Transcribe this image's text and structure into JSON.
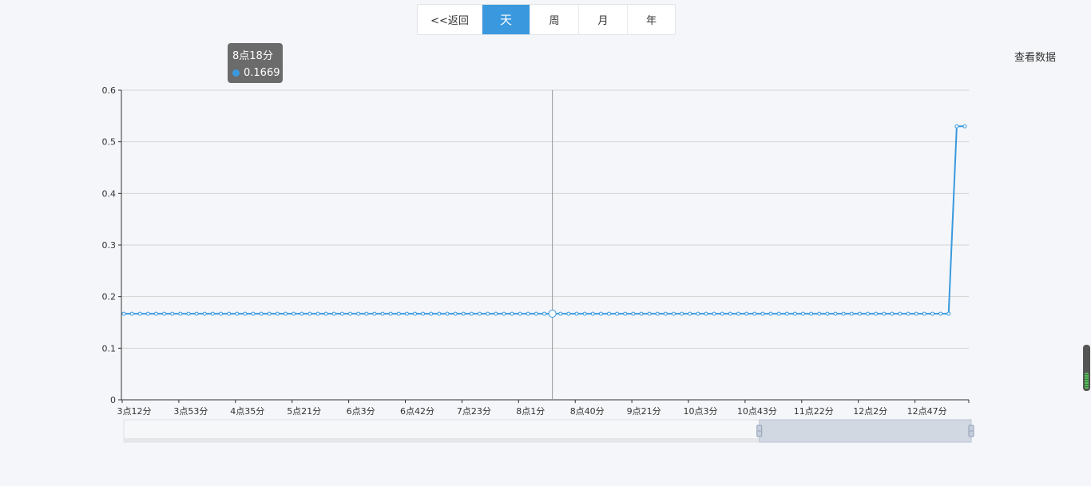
{
  "tabs": [
    {
      "label": "<<返回",
      "active": false
    },
    {
      "label": "天",
      "active": true
    },
    {
      "label": "周",
      "active": false
    },
    {
      "label": "月",
      "active": false
    },
    {
      "label": "年",
      "active": false
    }
  ],
  "view_data_label": "查看数据",
  "tooltip": {
    "time": "8点18分",
    "value": "0.1669"
  },
  "colors": {
    "accent": "#3a99de",
    "series": "#3a99de",
    "grid": "#d4d4d4",
    "tooltip_bg": "#6b6b6b"
  },
  "chart_data": {
    "type": "line",
    "title": "",
    "xlabel": "",
    "ylabel": "",
    "ylim": [
      0,
      0.6
    ],
    "yticks": [
      "0",
      "0.1",
      "0.2",
      "0.3",
      "0.4",
      "0.5",
      "0.6"
    ],
    "x_tick_labels": [
      "3点12分",
      "3点53分",
      "4点35分",
      "5点21分",
      "6点3分",
      "6点42分",
      "7点23分",
      "8点1分",
      "8点40分",
      "9点21分",
      "10点3分",
      "10点43分",
      "11点22分",
      "12点2分",
      "12点47分"
    ],
    "series": [
      {
        "values": [
          0.1669,
          0.1669,
          0.1669,
          0.1669,
          0.1669,
          0.1669,
          0.1669,
          0.1669,
          0.1669,
          0.1669,
          0.1669,
          0.1669,
          0.1669,
          0.1669,
          0.1669,
          0.1669,
          0.1669,
          0.1669,
          0.1669,
          0.1669,
          0.1669,
          0.1669,
          0.1669,
          0.1669,
          0.1669,
          0.1669,
          0.1669,
          0.1669,
          0.1669,
          0.1669,
          0.1669,
          0.1669,
          0.1669,
          0.1669,
          0.1669,
          0.1669,
          0.1669,
          0.1669,
          0.1669,
          0.1669,
          0.1669,
          0.1669,
          0.1669,
          0.1669,
          0.1669,
          0.1669,
          0.1669,
          0.1669,
          0.1669,
          0.1669,
          0.1669,
          0.1669,
          0.1669,
          0.1669,
          0.1669,
          0.1669,
          0.1669,
          0.1669,
          0.1669,
          0.1669,
          0.1669,
          0.1669,
          0.1669,
          0.1669,
          0.1669,
          0.1669,
          0.1669,
          0.1669,
          0.1669,
          0.1669,
          0.1669,
          0.1669,
          0.1669,
          0.1669,
          0.1669,
          0.1669,
          0.1669,
          0.1669,
          0.1669,
          0.1669,
          0.1669,
          0.1669,
          0.1669,
          0.1669,
          0.1669,
          0.1669,
          0.1669,
          0.1669,
          0.1669,
          0.1669,
          0.1669,
          0.1669,
          0.1669,
          0.1669,
          0.1669,
          0.1669,
          0.1669,
          0.1669,
          0.1669,
          0.1669,
          0.1669,
          0.1669,
          0.1669,
          0.53,
          0.53
        ]
      }
    ],
    "highlighted_index": 53,
    "grid": true,
    "datazoom": {
      "start": 0.75,
      "end": 1.0
    }
  }
}
